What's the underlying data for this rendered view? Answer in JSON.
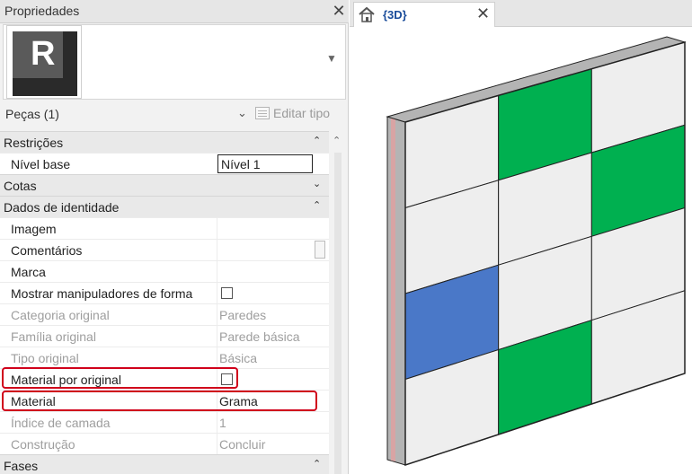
{
  "properties_panel": {
    "title": "Propriedades",
    "close_glyph": "✕",
    "type_selector": {
      "logo_letter": "R",
      "dropdown_icon": "triangle-down"
    },
    "instance_filter": "Peças (1)",
    "edit_type": "Editar tipo",
    "groups": {
      "restricoes": {
        "label": "Restrições",
        "toggle": "⌃⌃"
      },
      "cotas": {
        "label": "Cotas",
        "toggle": "⌄⌄"
      },
      "dados": {
        "label": "Dados de identidade",
        "toggle": "⌃⌃"
      },
      "fases": {
        "label": "Fases",
        "toggle": "⌃⌃"
      }
    },
    "rows": {
      "nivel_base": {
        "name": "Nível base",
        "value": "Nível 1"
      },
      "imagem": {
        "name": "Imagem",
        "value": ""
      },
      "comentarios": {
        "name": "Comentários",
        "value": ""
      },
      "marca": {
        "name": "Marca",
        "value": ""
      },
      "manipuladores": {
        "name": "Mostrar manipuladores de forma",
        "checked": false
      },
      "categoria": {
        "name": "Categoria original",
        "value": "Paredes"
      },
      "familia": {
        "name": "Família original",
        "value": "Parede básica"
      },
      "tipo": {
        "name": "Tipo original",
        "value": "Básica"
      },
      "material_por_original": {
        "name": "Material por original",
        "checked": false
      },
      "material": {
        "name": "Material",
        "value": "Grama"
      },
      "indice": {
        "name": "Índice de camada",
        "value": "1"
      },
      "construcao": {
        "name": "Construção",
        "value": "Concluir"
      }
    }
  },
  "view": {
    "tab_label": "{3D}",
    "tab_close": "✕",
    "home_icon": "house-icon",
    "colors": {
      "green": "#00b050",
      "white_panel": "#eeeeee",
      "blue_panel": "#4a78c8",
      "edge": "#222222",
      "wall_core": "#b4b4b4",
      "wall_finish": "#d8a4a4"
    },
    "panel_grid": [
      [
        "white",
        "green",
        "white"
      ],
      [
        "white",
        "white",
        "green"
      ],
      [
        "blue",
        "white",
        "white"
      ],
      [
        "white",
        "green",
        "white"
      ]
    ]
  },
  "highlight_color": "#d0021b"
}
